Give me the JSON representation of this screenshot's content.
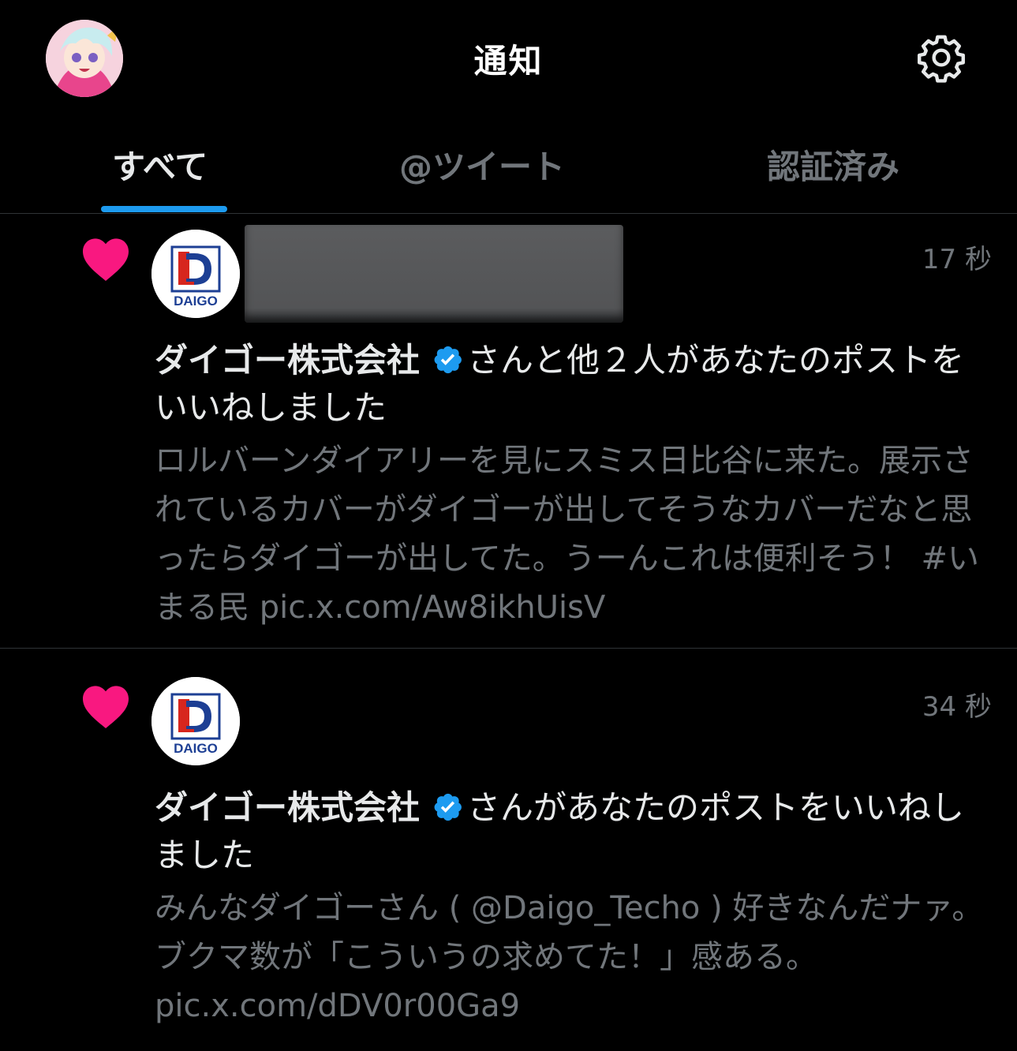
{
  "header": {
    "title": "通知"
  },
  "tabs": [
    {
      "label": "すべて",
      "active": true
    },
    {
      "label": "@ツイート",
      "active": false
    },
    {
      "label": "認証済み",
      "active": false
    }
  ],
  "notifications": [
    {
      "time": "17 秒",
      "name": "ダイゴー株式会社",
      "action": "さんと他２人があなたのポストをいいねしました",
      "text": "ロルバーンダイアリーを見にスミス日比谷に来た。展示されているカバーがダイゴーが出してそうなカバーだなと思ったらダイゴーが出してた。うーんこれは便利そう！ #いまる民 pic.x.com/Aw8ikhUisV",
      "logo_text": "DAIGO"
    },
    {
      "time": "34 秒",
      "name": "ダイゴー株式会社",
      "action": "さんがあなたのポストをいいねしました",
      "text": "みんなダイゴーさん ( @Daigo_Techo ) 好きなんだナァ。ブクマ数が「こういうの求めてた！」感ある。 pic.x.com/dDV0r00Ga9",
      "logo_text": "DAIGO"
    }
  ],
  "colors": {
    "accent": "#1d9bf0",
    "like": "#f91880",
    "muted": "#71767b",
    "logo_red": "#d7261e",
    "logo_blue": "#1d3f94"
  },
  "icons": [
    "gear-icon",
    "heart-icon",
    "verified-badge-icon"
  ]
}
